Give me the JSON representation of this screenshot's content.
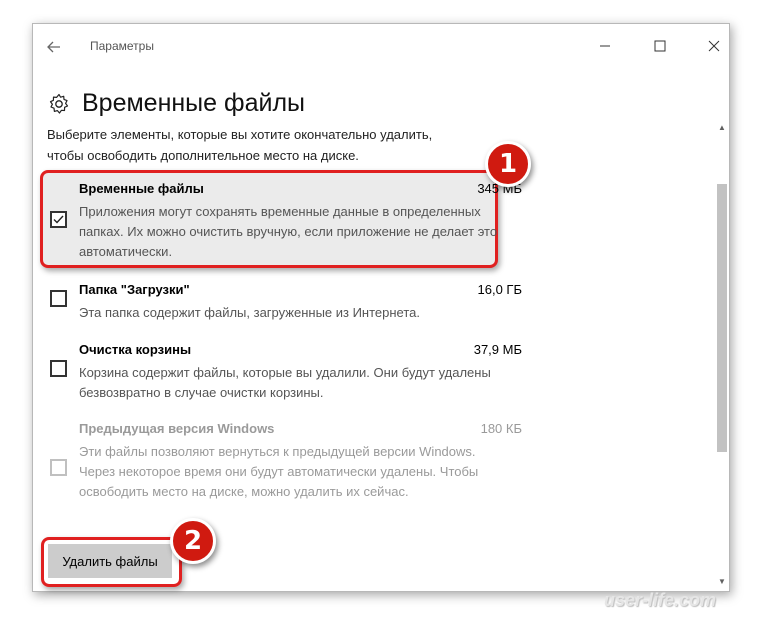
{
  "window": {
    "title": "Параметры"
  },
  "page": {
    "title": "Временные файлы",
    "description_line1": "Выберите элементы, которые вы хотите окончательно удалить,",
    "description_line2": "чтобы освободить дополнительное место на диске."
  },
  "items": [
    {
      "name": "Временные файлы",
      "size": "345 МБ",
      "text": "Приложения могут сохранять временные данные в определенных папках. Их можно очистить вручную, если приложение не делает это автоматически.",
      "checked": true,
      "enabled": true
    },
    {
      "name": "Папка \"Загрузки\"",
      "size": "16,0 ГБ",
      "text": "Эта папка содержит файлы, загруженные из Интернета.",
      "checked": false,
      "enabled": true
    },
    {
      "name": "Очистка корзины",
      "size": "37,9 МБ",
      "text": "Корзина содержит файлы, которые вы удалили. Они будут удалены безвозвратно в случае очистки корзины.",
      "checked": false,
      "enabled": true
    },
    {
      "name": "Предыдущая версия Windows",
      "size": "180 КБ",
      "text": "Эти файлы позволяют вернуться к предыдущей версии Windows. Через некоторое время они будут автоматически удалены. Чтобы освободить место на диске, можно удалить их сейчас.",
      "checked": false,
      "enabled": false
    }
  ],
  "actions": {
    "delete_label": "Удалить файлы"
  },
  "annotations": {
    "badge1": "1",
    "badge2": "2",
    "highlight_color": "#e02020",
    "badge_color": "#d01a10"
  },
  "watermark": "user-life.com",
  "icons": {
    "back": "back-arrow-icon",
    "settings": "gear-icon",
    "minimize": "minimize-icon",
    "maximize": "maximize-icon",
    "close": "close-icon",
    "check": "checkmark-icon"
  }
}
